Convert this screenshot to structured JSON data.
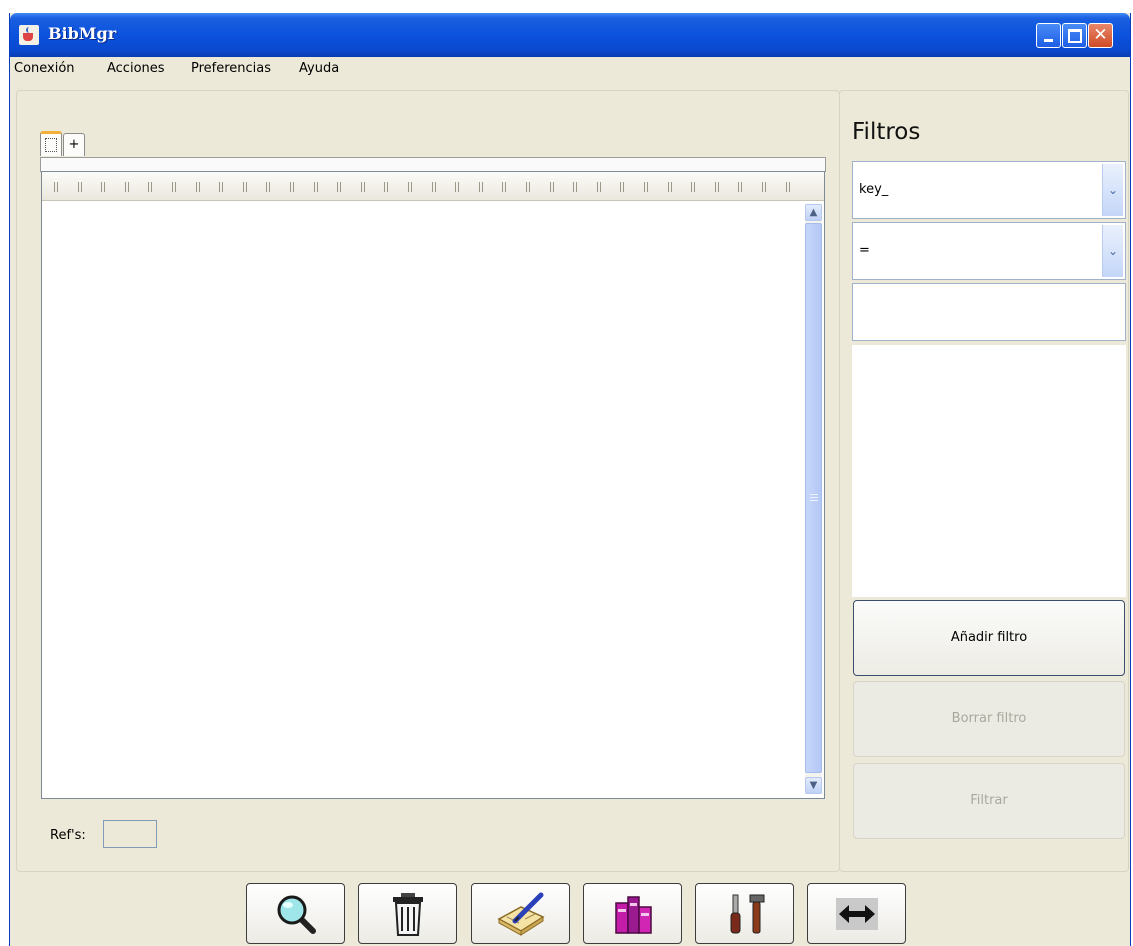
{
  "window": {
    "title": "BibMgr"
  },
  "menu": [
    "Conexión",
    "Acciones",
    "Preferencias",
    "Ayuda"
  ],
  "tabs": [
    {
      "label": "",
      "selected": true
    },
    {
      "label": "+",
      "selected": false
    }
  ],
  "refs": {
    "label": "Ref's:",
    "value": ""
  },
  "filters": {
    "title": "Filtros",
    "field_value": "key_",
    "operator_value": "=",
    "text_value": "",
    "add_label": "Añadir filtro",
    "delete_label": "Borrar filtro",
    "apply_label": "Filtrar"
  },
  "toolbar_icons": [
    "search-icon",
    "trash-icon",
    "edit-book-icon",
    "books-icon",
    "tools-icon",
    "swap-arrows-icon"
  ],
  "colors": {
    "titlebar": "#0b52dd",
    "window_bg": "#ece9d8",
    "disabled_text": "#a9a89d"
  }
}
